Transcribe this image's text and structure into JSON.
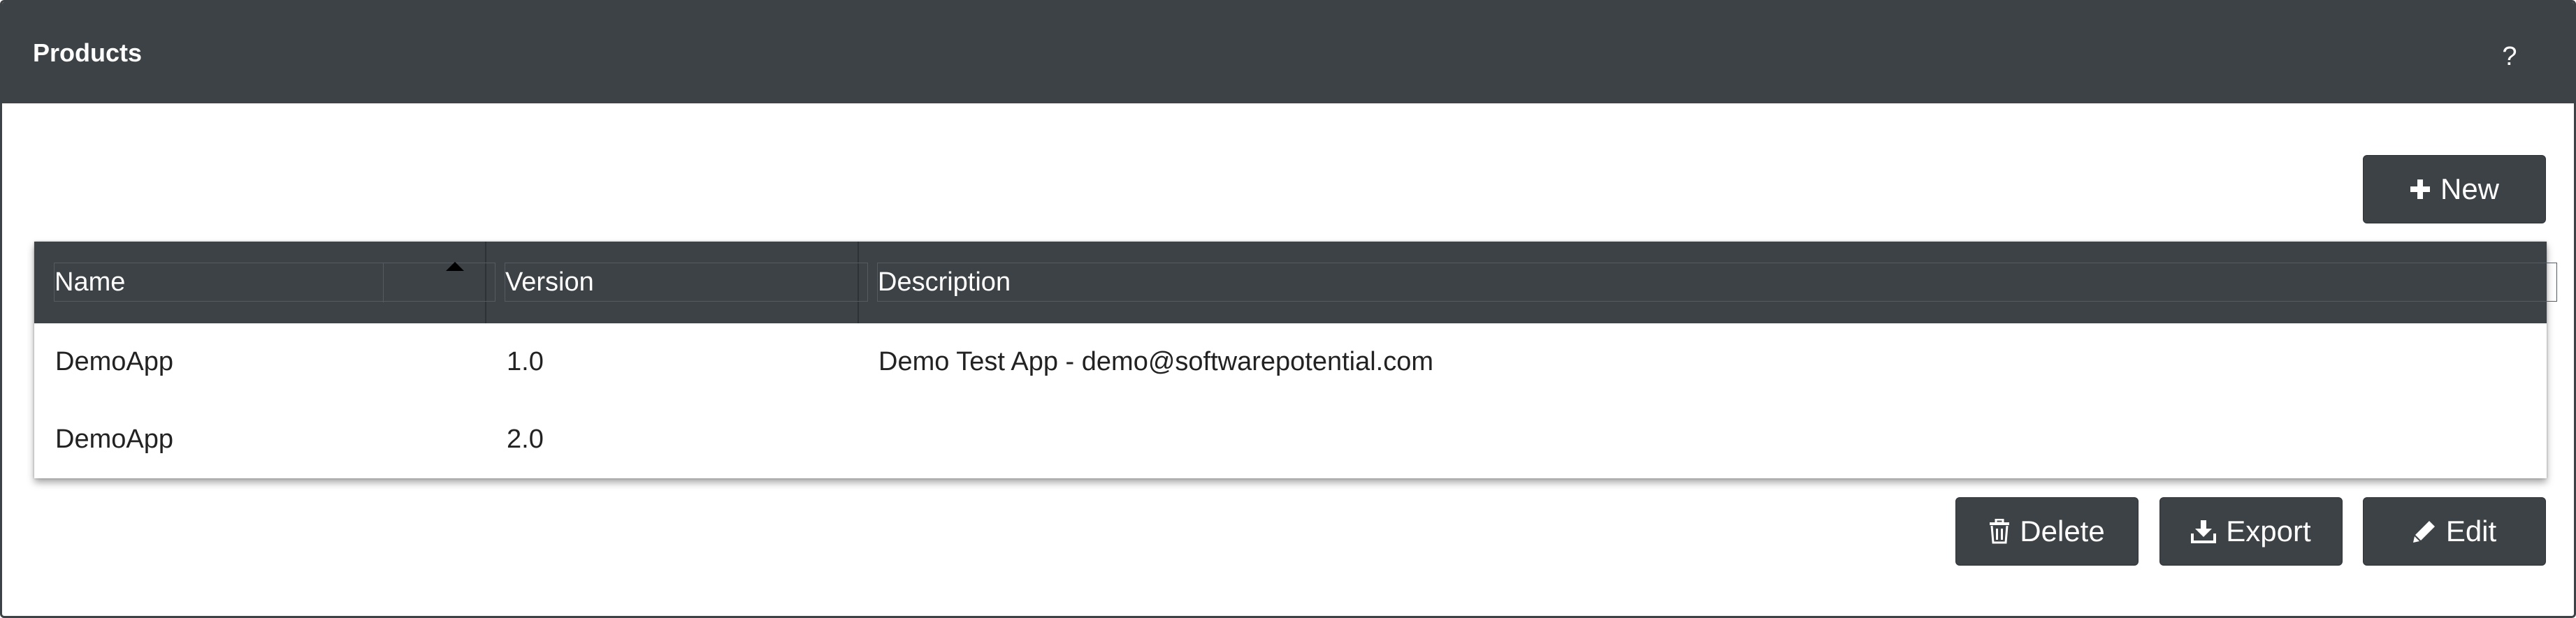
{
  "panel": {
    "title": "Products",
    "help_label": "?"
  },
  "toolbar": {
    "new_label": "New"
  },
  "table": {
    "columns": [
      "Name",
      "Version",
      "Description"
    ],
    "sort": {
      "column": "Name",
      "direction": "ascending"
    },
    "rows": [
      {
        "name": "DemoApp",
        "version": "1.0",
        "description": "Demo Test App - demo@softwarepotential.com"
      },
      {
        "name": "DemoApp",
        "version": "2.0",
        "description": ""
      }
    ]
  },
  "actions": {
    "delete_label": "Delete",
    "export_label": "Export",
    "edit_label": "Edit"
  },
  "colors": {
    "header_bg": "#3d4246",
    "button_bg": "#3d4246",
    "text": "#222222"
  },
  "icons": {
    "new": "plus-icon",
    "delete": "trash-icon",
    "export": "download-icon",
    "edit": "pencil-icon",
    "sort": "sort-ascending-icon"
  }
}
